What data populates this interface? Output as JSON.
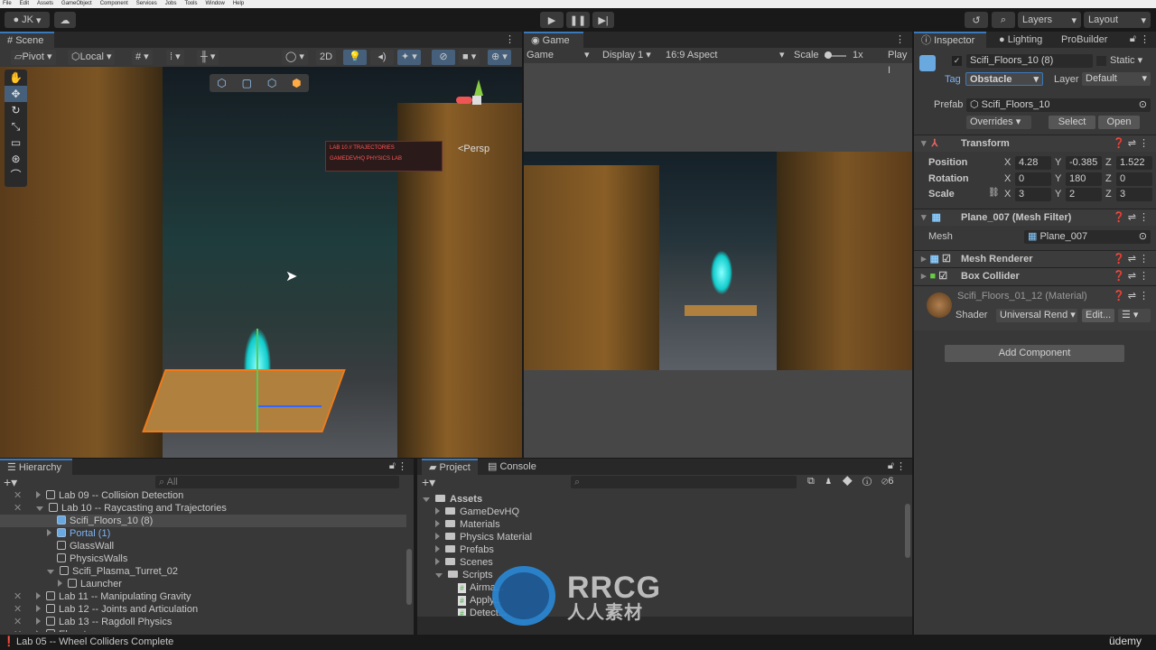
{
  "menu": [
    "File",
    "Edit",
    "Assets",
    "GameObject",
    "Component",
    "Services",
    "Jobs",
    "Tools",
    "Window",
    "Help"
  ],
  "toolbar": {
    "account": "JK",
    "layers": "Layers",
    "layout": "Layout"
  },
  "scene": {
    "tab": "Scene",
    "pivot": "Pivot",
    "local": "Local",
    "mode2d": "2D",
    "persp": "<Persp",
    "sign_line1": "LAB 10 // TRAJECTORIES",
    "sign_line2": "GAMEDEVHQ PHYSICS LAB"
  },
  "game": {
    "tab": "Game",
    "mode": "Game",
    "display": "Display 1",
    "aspect": "16:9 Aspect",
    "scale_label": "Scale",
    "scale_value": "1x",
    "play_label": "Play I"
  },
  "inspector": {
    "tabs": [
      "Inspector",
      "Lighting",
      "ProBuilder"
    ],
    "object_name": "Scifi_Floors_10 (8)",
    "static_label": "Static",
    "tag_label": "Tag",
    "tag": "Obstacle",
    "layer_label": "Layer",
    "layer": "Default",
    "prefab_label": "Prefab",
    "prefab": "Scifi_Floors_10",
    "overrides": "Overrides",
    "select": "Select",
    "open": "Open",
    "transform": {
      "title": "Transform",
      "position_label": "Position",
      "position": {
        "x": "4.28",
        "y": "-0.385",
        "z": "1.522"
      },
      "rotation_label": "Rotation",
      "rotation": {
        "x": "0",
        "y": "180",
        "z": "0"
      },
      "scale_label": "Scale",
      "scale": {
        "x": "3",
        "y": "2",
        "z": "3"
      }
    },
    "mesh_filter": {
      "title": "Plane_007 (Mesh Filter)",
      "mesh_label": "Mesh",
      "mesh": "Plane_007"
    },
    "mesh_renderer": "Mesh Renderer",
    "box_collider": "Box Collider",
    "material": {
      "name": "Scifi_Floors_01_12 (Material)",
      "shader_label": "Shader",
      "shader": "Universal Rend",
      "edit": "Edit..."
    },
    "add_component": "Add Component"
  },
  "hierarchy": {
    "tab": "Hierarchy",
    "search_placeholder": "All",
    "items": [
      {
        "label": "Lab 09 -- Collision Detection",
        "indent": 1,
        "arrow": "right"
      },
      {
        "label": "Lab 10 -- Raycasting and Trajectories",
        "indent": 1,
        "arrow": "down"
      },
      {
        "label": "Scifi_Floors_10 (8)",
        "indent": 2,
        "arrow": "none",
        "prefab": true,
        "selected": true
      },
      {
        "label": "Portal (1)",
        "indent": 2,
        "arrow": "right",
        "prefab": true,
        "blue": true
      },
      {
        "label": "GlassWall",
        "indent": 2,
        "arrow": "none"
      },
      {
        "label": "PhysicsWalls",
        "indent": 2,
        "arrow": "none"
      },
      {
        "label": "Scifi_Plasma_Turret_02",
        "indent": 2,
        "arrow": "down"
      },
      {
        "label": "Launcher",
        "indent": 3,
        "arrow": "right"
      },
      {
        "label": "Lab 11 -- Manipulating Gravity",
        "indent": 1,
        "arrow": "right"
      },
      {
        "label": "Lab 12 -- Joints and Articulation",
        "indent": 1,
        "arrow": "right"
      },
      {
        "label": "Lab 13 -- Ragdoll Physics",
        "indent": 1,
        "arrow": "right"
      },
      {
        "label": "Elevator",
        "indent": 1,
        "arrow": "right"
      }
    ]
  },
  "project": {
    "tabs": [
      "Project",
      "Console"
    ],
    "hidden_count": "6",
    "items": [
      {
        "label": "Assets",
        "indent": 0,
        "arrow": "down",
        "type": "folder-open"
      },
      {
        "label": "GameDevHQ",
        "indent": 1,
        "arrow": "right",
        "type": "folder"
      },
      {
        "label": "Materials",
        "indent": 1,
        "arrow": "right",
        "type": "folder"
      },
      {
        "label": "Physics Material",
        "indent": 1,
        "arrow": "right",
        "type": "folder"
      },
      {
        "label": "Prefabs",
        "indent": 1,
        "arrow": "right",
        "type": "folder"
      },
      {
        "label": "Scenes",
        "indent": 1,
        "arrow": "right",
        "type": "folder"
      },
      {
        "label": "Scripts",
        "indent": 1,
        "arrow": "down",
        "type": "folder-open"
      },
      {
        "label": "Airma...",
        "indent": 2,
        "arrow": "none",
        "type": "script"
      },
      {
        "label": "Apply...",
        "indent": 2,
        "arrow": "none",
        "type": "script"
      },
      {
        "label": "Detect...",
        "indent": 2,
        "arrow": "none",
        "type": "script"
      }
    ]
  },
  "status": {
    "message": "Lab 05 -- Wheel Colliders Complete",
    "udemy": "üdemy"
  },
  "watermark": {
    "logo": "RRCG",
    "sub": "人人素材"
  },
  "colors": {
    "accent": "#3a79bb",
    "selected_text": "#7fb2f0",
    "portal": "#2ee6ea"
  }
}
